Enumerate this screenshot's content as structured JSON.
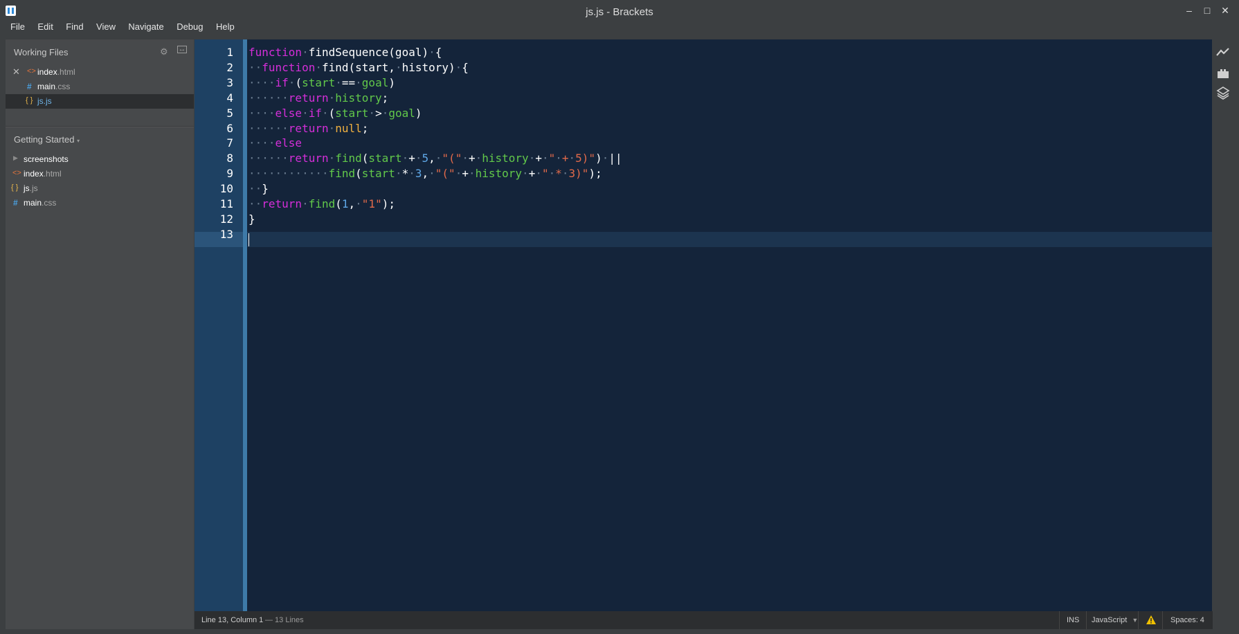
{
  "window": {
    "title": "js.js - Brackets"
  },
  "menu": [
    "File",
    "Edit",
    "Find",
    "View",
    "Navigate",
    "Debug",
    "Help"
  ],
  "sidebar": {
    "working_files_title": "Working Files",
    "working_files": [
      {
        "base": "index",
        "ext": ".html",
        "type": "html"
      },
      {
        "base": "main",
        "ext": ".css",
        "type": "css"
      },
      {
        "base": "js",
        "ext": ".js",
        "type": "js",
        "selected": true
      }
    ],
    "project_title": "Getting Started",
    "project_files": [
      {
        "base": "screenshots",
        "ext": "",
        "type": "folder"
      },
      {
        "base": "index",
        "ext": ".html",
        "type": "html"
      },
      {
        "base": "js",
        "ext": ".js",
        "type": "js"
      },
      {
        "base": "main",
        "ext": ".css",
        "type": "css"
      }
    ]
  },
  "editor": {
    "line_numbers": [
      "1",
      "2",
      "3",
      "4",
      "5",
      "6",
      "7",
      "8",
      "9",
      "10",
      "11",
      "12",
      "13"
    ],
    "lines": [
      [
        [
          "kw",
          "function"
        ],
        [
          "ws",
          "·"
        ],
        [
          "fn",
          "findSequence(goal)"
        ],
        [
          "ws",
          "·"
        ],
        [
          "op",
          "{"
        ]
      ],
      [
        [
          "ws",
          "··"
        ],
        [
          "kw",
          "function"
        ],
        [
          "ws",
          "·"
        ],
        [
          "fn",
          "find(start,"
        ],
        [
          "ws",
          "·"
        ],
        [
          "fn",
          "history)"
        ],
        [
          "ws",
          "·"
        ],
        [
          "op",
          "{"
        ]
      ],
      [
        [
          "ws",
          "····"
        ],
        [
          "kw",
          "if"
        ],
        [
          "ws",
          "·"
        ],
        [
          "op",
          "("
        ],
        [
          "var",
          "start"
        ],
        [
          "ws",
          "·"
        ],
        [
          "op",
          "=="
        ],
        [
          "ws",
          "·"
        ],
        [
          "var",
          "goal"
        ],
        [
          "op",
          ")"
        ]
      ],
      [
        [
          "ws",
          "······"
        ],
        [
          "kw",
          "return"
        ],
        [
          "ws",
          "·"
        ],
        [
          "var",
          "history"
        ],
        [
          "op",
          ";"
        ]
      ],
      [
        [
          "ws",
          "····"
        ],
        [
          "kw",
          "else"
        ],
        [
          "ws",
          "·"
        ],
        [
          "kw",
          "if"
        ],
        [
          "ws",
          "·"
        ],
        [
          "op",
          "("
        ],
        [
          "var",
          "start"
        ],
        [
          "ws",
          "·"
        ],
        [
          "op",
          ">"
        ],
        [
          "ws",
          "·"
        ],
        [
          "var",
          "goal"
        ],
        [
          "op",
          ")"
        ]
      ],
      [
        [
          "ws",
          "······"
        ],
        [
          "kw",
          "return"
        ],
        [
          "ws",
          "·"
        ],
        [
          "atom",
          "null"
        ],
        [
          "op",
          ";"
        ]
      ],
      [
        [
          "ws",
          "····"
        ],
        [
          "kw",
          "else"
        ]
      ],
      [
        [
          "ws",
          "······"
        ],
        [
          "kw",
          "return"
        ],
        [
          "ws",
          "·"
        ],
        [
          "var",
          "find"
        ],
        [
          "op",
          "("
        ],
        [
          "var",
          "start"
        ],
        [
          "ws",
          "·"
        ],
        [
          "op",
          "+"
        ],
        [
          "ws",
          "·"
        ],
        [
          "num",
          "5"
        ],
        [
          "op",
          ","
        ],
        [
          "ws",
          "·"
        ],
        [
          "str",
          "\"(\""
        ],
        [
          "ws",
          "·"
        ],
        [
          "op",
          "+"
        ],
        [
          "ws",
          "·"
        ],
        [
          "var",
          "history"
        ],
        [
          "ws",
          "·"
        ],
        [
          "op",
          "+"
        ],
        [
          "ws",
          "·"
        ],
        [
          "str",
          "\""
        ],
        [
          "ws",
          "·"
        ],
        [
          "str",
          "+"
        ],
        [
          "ws",
          "·"
        ],
        [
          "str",
          "5)\""
        ],
        [
          "op",
          ")"
        ],
        [
          "ws",
          "·"
        ],
        [
          "op",
          "||"
        ]
      ],
      [
        [
          "ws",
          "············"
        ],
        [
          "var",
          "find"
        ],
        [
          "op",
          "("
        ],
        [
          "var",
          "start"
        ],
        [
          "ws",
          "·"
        ],
        [
          "op",
          "*"
        ],
        [
          "ws",
          "·"
        ],
        [
          "num",
          "3"
        ],
        [
          "op",
          ","
        ],
        [
          "ws",
          "·"
        ],
        [
          "str",
          "\"(\""
        ],
        [
          "ws",
          "·"
        ],
        [
          "op",
          "+"
        ],
        [
          "ws",
          "·"
        ],
        [
          "var",
          "history"
        ],
        [
          "ws",
          "·"
        ],
        [
          "op",
          "+"
        ],
        [
          "ws",
          "·"
        ],
        [
          "str",
          "\""
        ],
        [
          "ws",
          "·"
        ],
        [
          "str",
          "*"
        ],
        [
          "ws",
          "·"
        ],
        [
          "str",
          "3)\""
        ],
        [
          "op",
          ");"
        ]
      ],
      [
        [
          "ws",
          "··"
        ],
        [
          "op",
          "}"
        ]
      ],
      [
        [
          "ws",
          "··"
        ],
        [
          "kw",
          "return"
        ],
        [
          "ws",
          "·"
        ],
        [
          "var",
          "find"
        ],
        [
          "op",
          "("
        ],
        [
          "num",
          "1"
        ],
        [
          "op",
          ","
        ],
        [
          "ws",
          "·"
        ],
        [
          "str",
          "\"1\""
        ],
        [
          "op",
          ");"
        ]
      ],
      [
        [
          "op",
          "}"
        ]
      ],
      []
    ]
  },
  "status": {
    "position": "Line 13, Column 1",
    "lines": "— 13 Lines",
    "mode": "INS",
    "language": "JavaScript",
    "spaces": "Spaces: 4"
  },
  "colors": {
    "keyword": "#d52ed9",
    "variable": "#62c94a",
    "number": "#5fa8e8",
    "string": "#e26a4a",
    "atom": "#f0b040",
    "editor_bg": "#14243a",
    "gutter_bg": "#1e4163"
  }
}
